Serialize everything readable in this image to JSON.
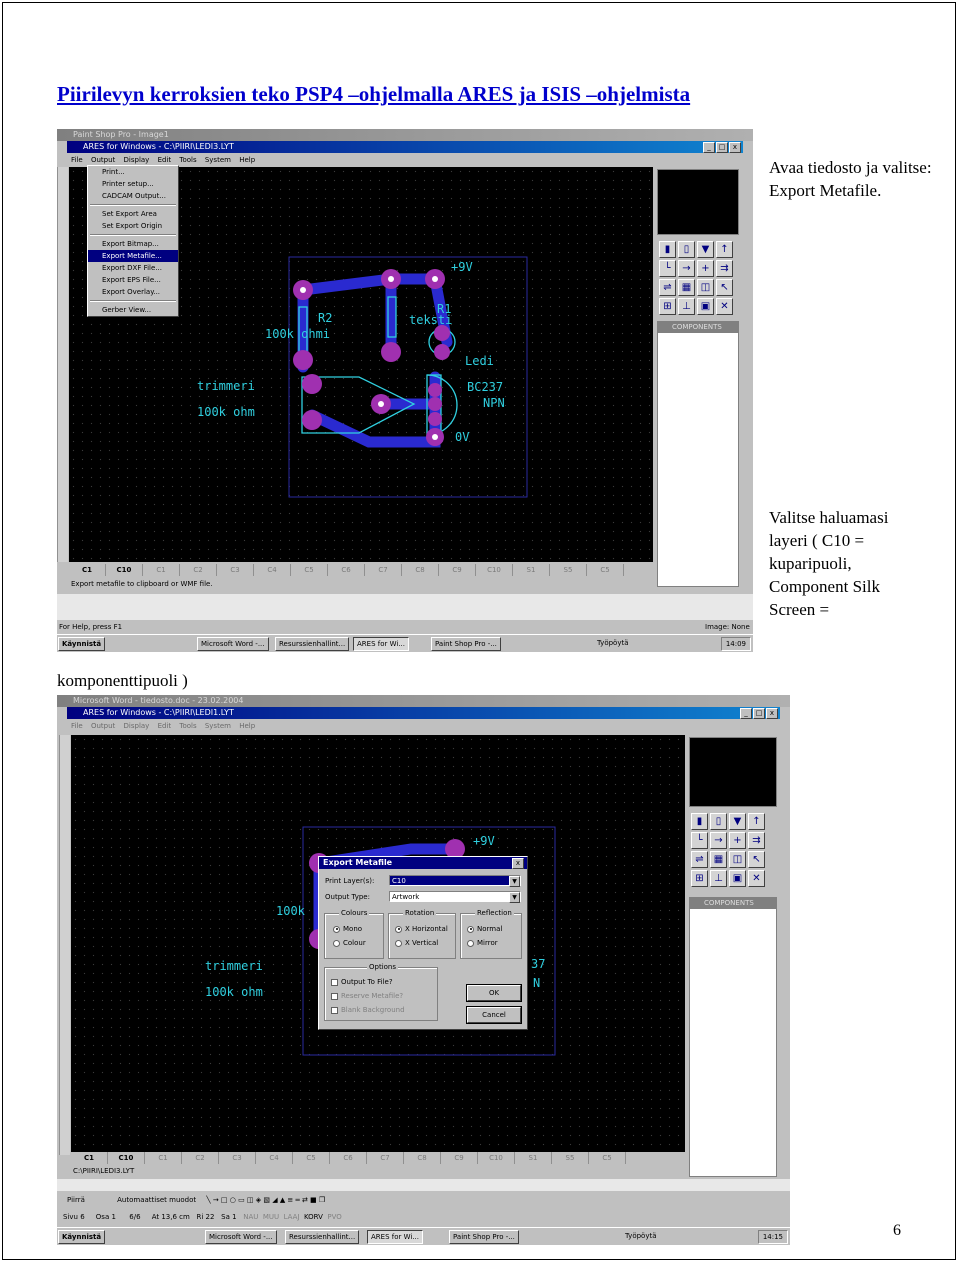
{
  "heading": "Piirilevyn kerroksien teko PSP4 –ohjelmalla ARES ja ISIS –ohjelmista",
  "notes": {
    "note1": "Avaa tiedosto ja valitse: Export Metafile.",
    "note2": "Valitse haluamasi layeri ( C10 = kuparipuoli, Component Silk Screen =",
    "note2_cont": "komponenttipuoli )"
  },
  "page_number": "6",
  "shot1": {
    "outer_title": "Paint Shop Pro - Image1",
    "app_title": "ARES for Windows - C:\\PIIRI\\LEDI3.LYT",
    "menu": [
      "File",
      "Output",
      "Display",
      "Edit",
      "Tools",
      "System",
      "Help"
    ],
    "file_menu": [
      "Print...",
      "Printer setup...",
      "CADCAM Output...",
      "Set Export Area",
      "Set Export Origin",
      "Export Bitmap...",
      "Export Metafile...",
      "Export DXF File...",
      "Export EPS File...",
      "Export Overlay...",
      "Gerber View..."
    ],
    "selected_item": "Export Metafile...",
    "pcb_labels": [
      "+9V",
      "R2",
      "100k ohmi",
      "R1",
      "teksti",
      "Ledi",
      "trimmeri",
      "100k ohm",
      "BC237",
      "NPN",
      "0V"
    ],
    "components_header": "COMPONENTS",
    "layers": [
      "C1",
      "C10",
      "C1",
      "C2",
      "C3",
      "C4",
      "C5",
      "C6",
      "C7",
      "C8",
      "C9",
      "C10",
      "S1",
      "S5",
      "C5"
    ],
    "status_msg": "Export metafile to clipboard or WMF file.",
    "help_text": "For Help, press F1",
    "image_info": "Image: None",
    "taskbar": {
      "start": "Käynnistä",
      "items": [
        "Microsoft Word -...",
        "Resurssienhallint...",
        "ARES for Wi...",
        "Paint Shop Pro -..."
      ],
      "tray_label": "Työpöytä",
      "clock": "14:09"
    }
  },
  "shot2": {
    "outer_title": "Microsoft Word - tiedosto.doc - 23.02.2004",
    "app_title": "ARES for Windows - C:\\PIIRI\\LEDI1.LYT",
    "menu": [
      "File",
      "Output",
      "Display",
      "Edit",
      "Tools",
      "System",
      "Help"
    ],
    "pcb_labels": [
      "+9V",
      "100k",
      "trimmeri",
      "100k ohm",
      "37",
      "N"
    ],
    "dialog": {
      "title": "Export Metafile",
      "close": "x",
      "print_layer_label": "Print Layer(s):",
      "print_layer_value": "C10",
      "output_type_label": "Output Type:",
      "output_type_value": "Artwork",
      "colours_label": "Colours",
      "colour_opts": [
        "Mono",
        "Colour"
      ],
      "rotation_label": "Rotation",
      "rotation_opts": [
        "X Horizontal",
        "X Vertical"
      ],
      "reflection_label": "Reflection",
      "reflection_opts": [
        "Normal",
        "Mirror"
      ],
      "options_label": "Options",
      "option_items": [
        "Output To File?",
        "Reserve Metafile?",
        "Blank Background"
      ],
      "ok": "OK",
      "cancel": "Cancel"
    },
    "components_header": "COMPONENTS",
    "layers": [
      "C1",
      "C10",
      "C1",
      "C2",
      "C3",
      "C4",
      "C5",
      "C6",
      "C7",
      "C8",
      "C9",
      "C10",
      "S1",
      "S5",
      "C5"
    ],
    "path_status": "C:\\PIIRI\\LEDI3.LYT",
    "word_toolbar": {
      "draw": "Piirrä",
      "autoshapes": "Automaattiset muodot"
    },
    "word_status": [
      "Sivu 6",
      "Osa 1",
      "6/6",
      "At 13,6 cm",
      "Ri 22",
      "Sa 1",
      "NAU",
      "MUU",
      "LAAJ",
      "KORV",
      "PVO"
    ],
    "taskbar": {
      "start": "Käynnistä",
      "items": [
        "Microsoft Word -...",
        "Resurssienhallint...",
        "ARES for Wi...",
        "Paint Shop Pro -..."
      ],
      "tray_label": "Työpöytä",
      "clock": "14:15"
    }
  },
  "colors": {
    "title_blue": "#0000cc",
    "copper_blue": "#2a2ad0",
    "pad_purple": "#a030b0",
    "silk_cyan": "#30d0e0"
  }
}
